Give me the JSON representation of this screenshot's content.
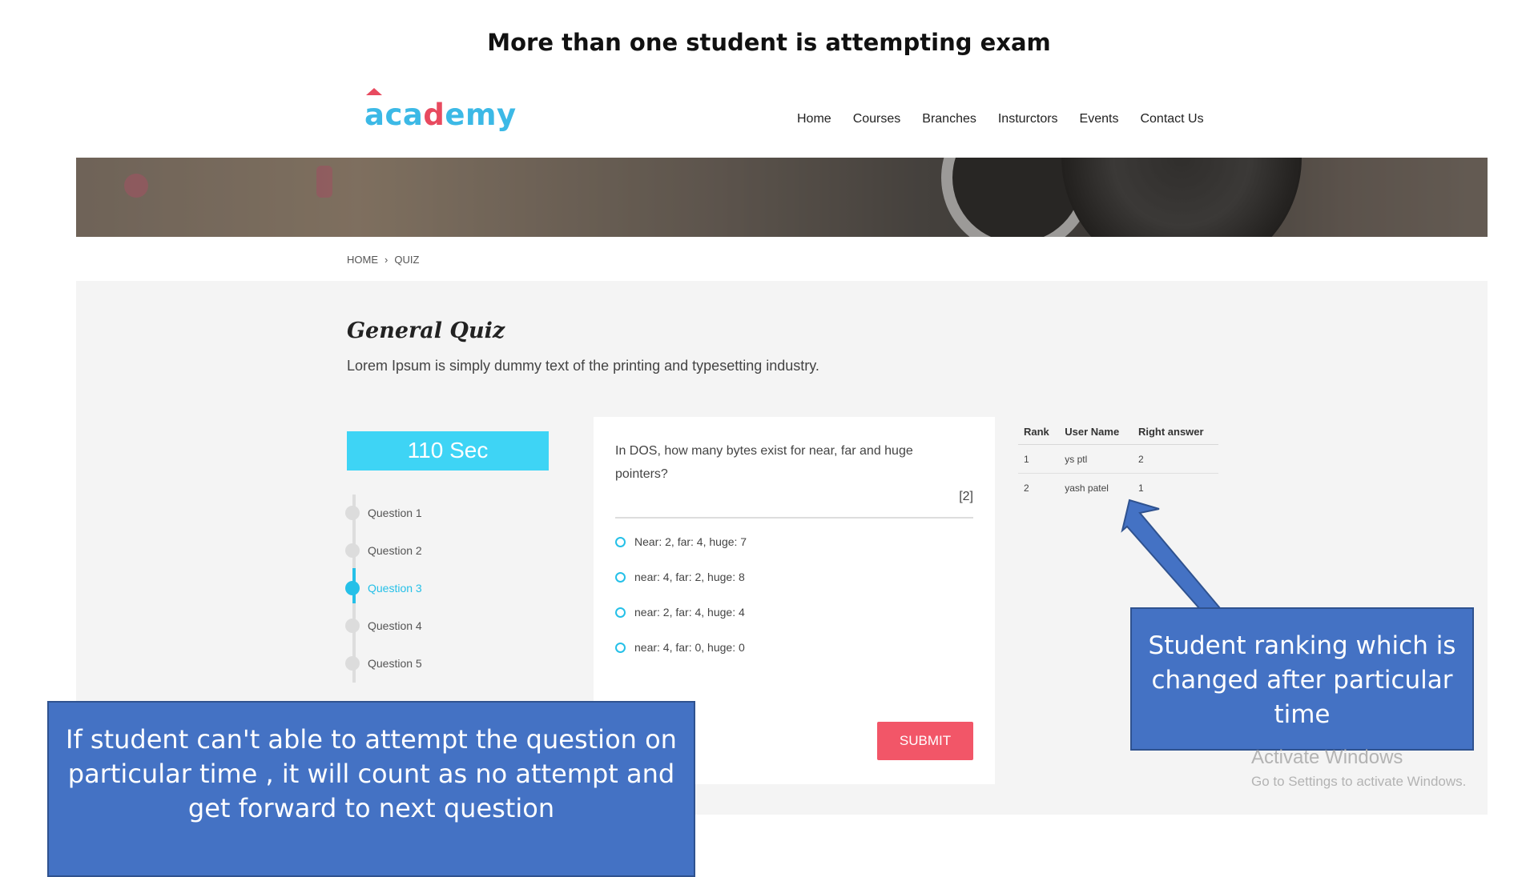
{
  "slide_title": "More  than one student is attempting exam",
  "header": {
    "logo_text_pre": "a",
    "logo_text_c": "ca",
    "logo_text_d": "d",
    "logo_text_post": "emy",
    "nav": [
      "Home",
      "Courses",
      "Branches",
      "Insturctors",
      "Events",
      "Contact Us"
    ]
  },
  "breadcrumb": {
    "home": "HOME",
    "separator": "›",
    "current": "QUIZ"
  },
  "quiz": {
    "title": "General Quiz",
    "description": "Lorem Ipsum is simply dummy text of the printing and typesetting industry.",
    "timer": "110 Sec",
    "questions": [
      "Question 1",
      "Question 2",
      "Question 3",
      "Question 4",
      "Question 5"
    ],
    "active_question_index": 2,
    "question_text": "In DOS, how many bytes exist for near, far and huge pointers?",
    "marks": "[2]",
    "options": [
      "Near: 2, far: 4, huge: 7",
      "near: 4, far: 2, huge: 8",
      "near: 2, far: 4, huge: 4",
      "near: 4, far: 0, huge: 0"
    ],
    "submit_label": "SUBMIT"
  },
  "ranking": {
    "headers": [
      "Rank",
      "User Name",
      "Right answer"
    ],
    "rows": [
      [
        "1",
        "ys ptl",
        "2"
      ],
      [
        "2",
        "yash patel",
        "1"
      ]
    ]
  },
  "callouts": {
    "left": "If student can't able to attempt the question on particular time , it will count as no attempt and get forward to next question",
    "right": "Student ranking which is changed after particular time"
  },
  "watermark": {
    "line1": "Activate Windows",
    "line2": "Go to Settings to activate Windows."
  },
  "colors": {
    "accent": "#3ed4f5",
    "submit": "#f25668",
    "callout": "#4472c4",
    "logo": "#3cb9e6"
  }
}
